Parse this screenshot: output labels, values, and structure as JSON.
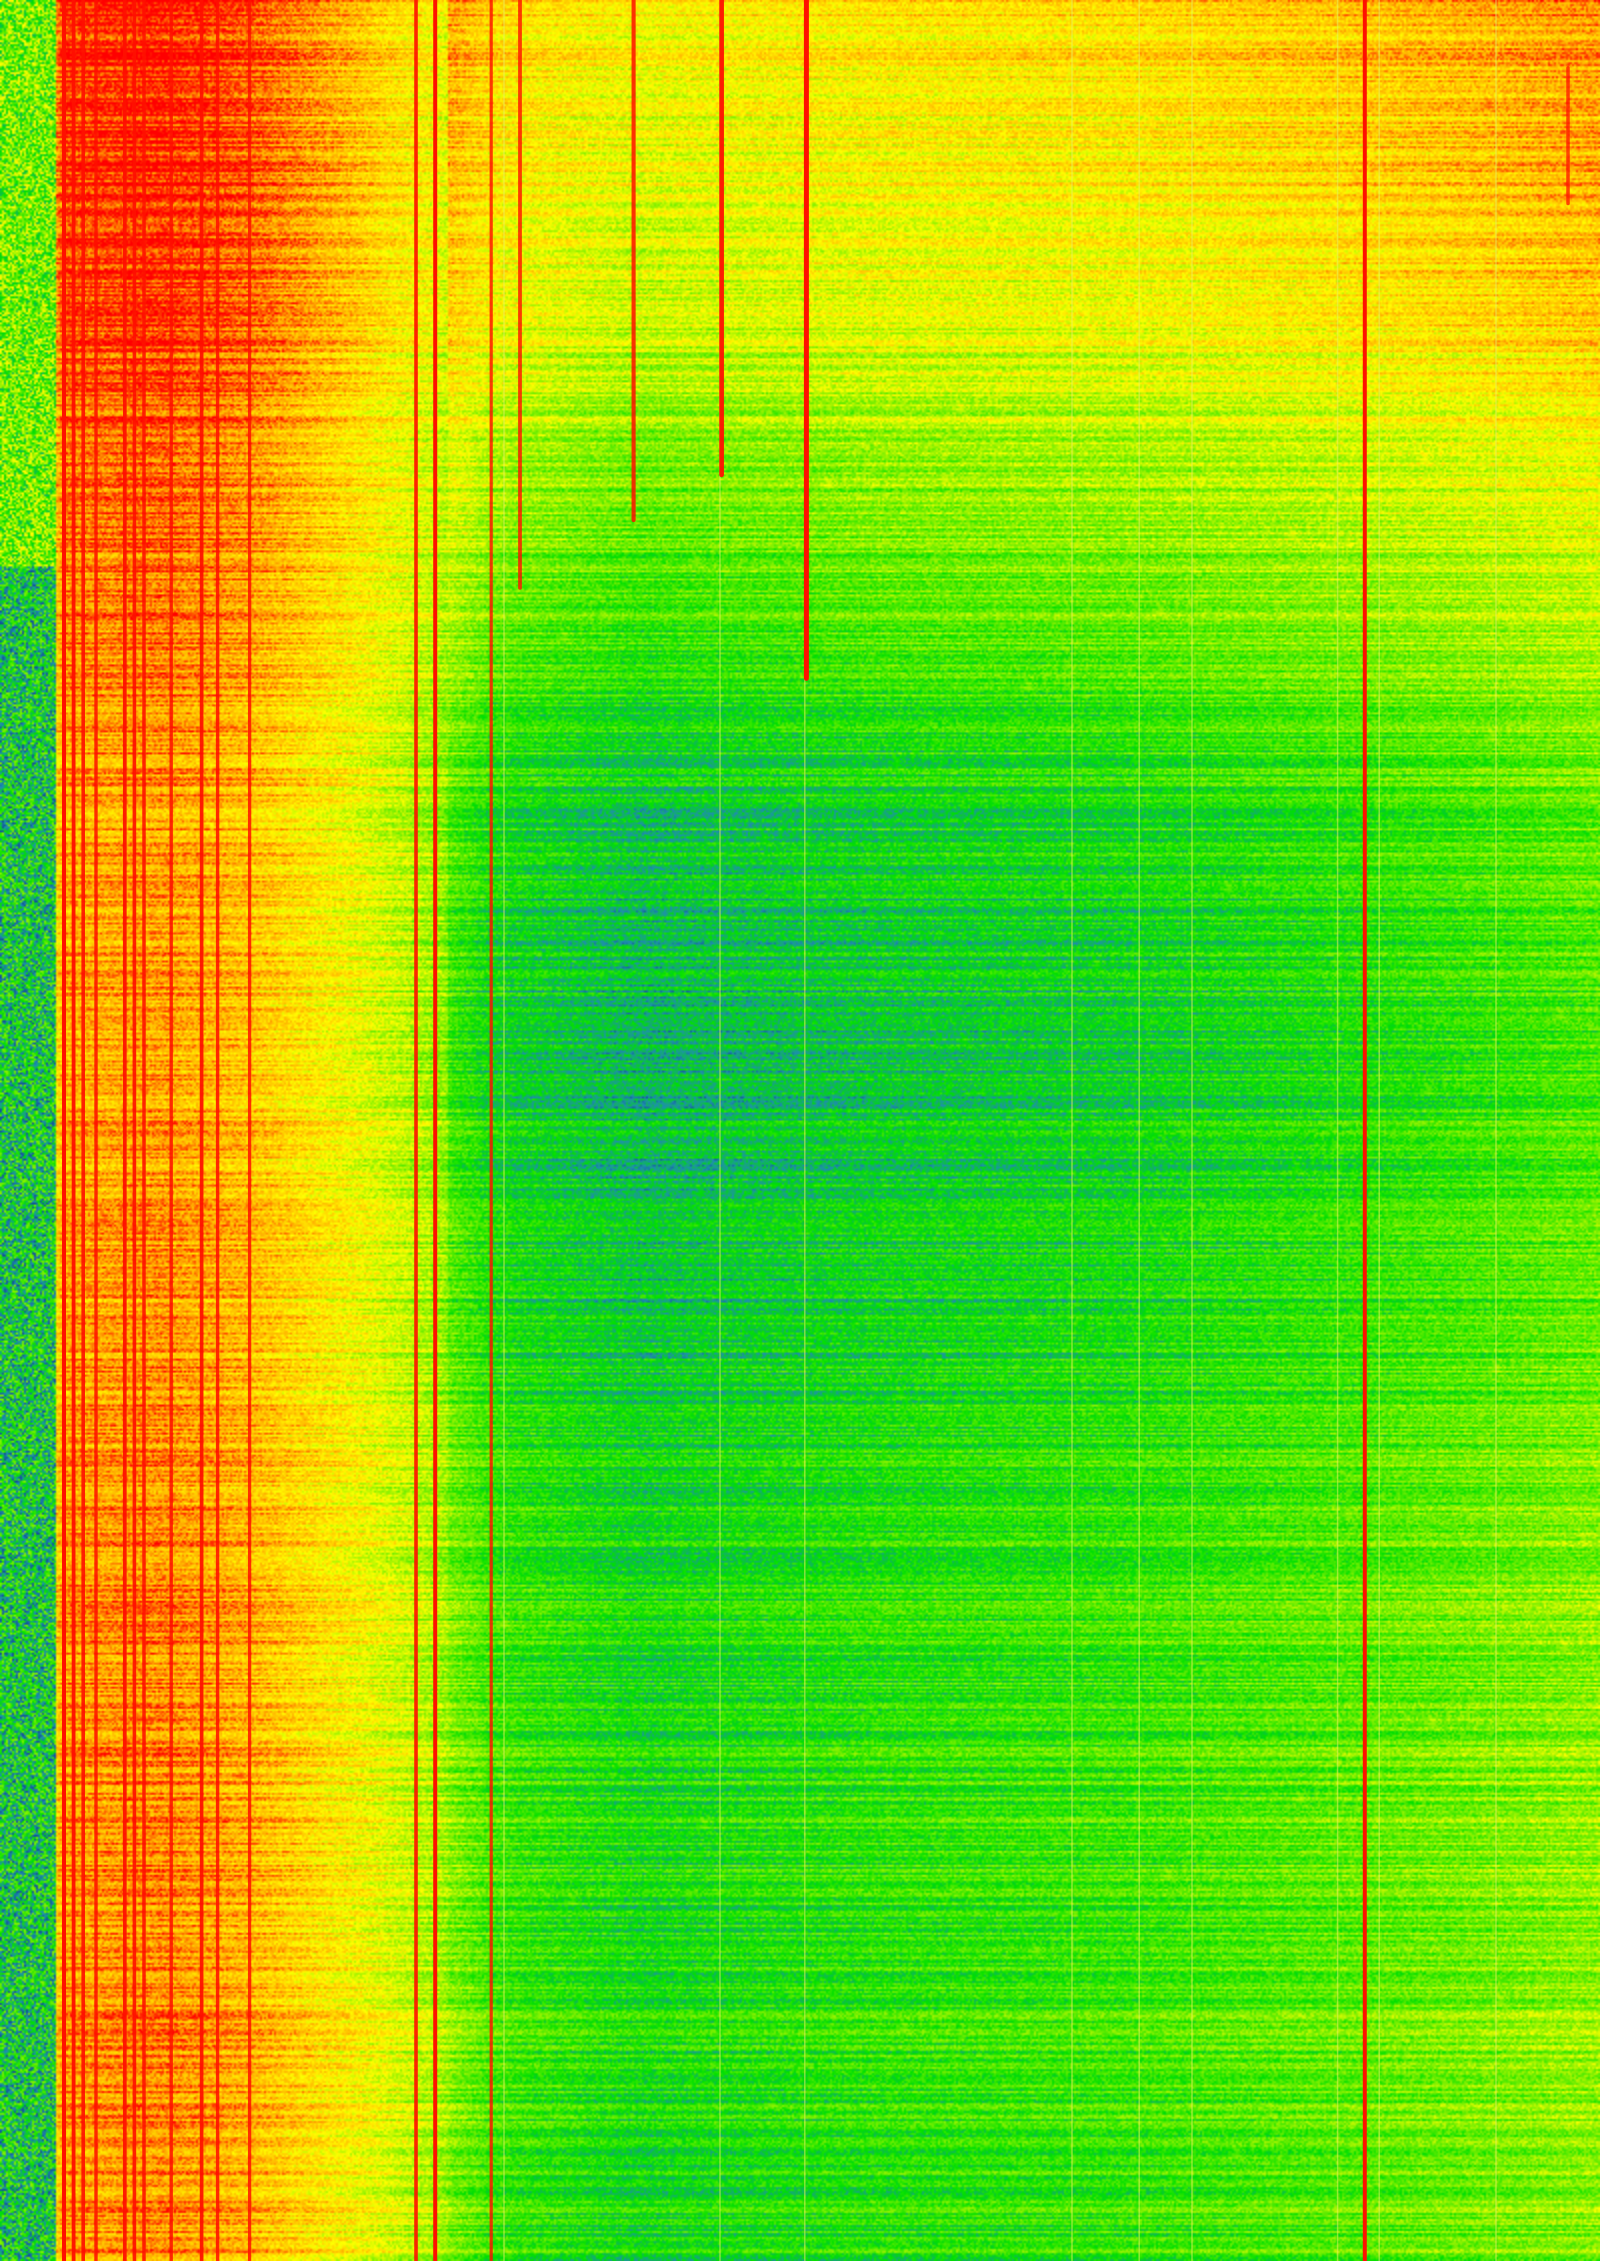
{
  "chart_data": {
    "type": "heatmap",
    "title": "",
    "xlabel": "",
    "ylabel": "",
    "colormap": [
      "#0a1a8c",
      "#1e8fb0",
      "#00e000",
      "#80f000",
      "#ffff00",
      "#ffb000",
      "#ff0000"
    ],
    "grid": false,
    "legend": "none",
    "x_range": [
      0,
      1
    ],
    "y_range": [
      0,
      1
    ],
    "background_intensity_profile": [
      {
        "x": 0.0,
        "value": 0.35
      },
      {
        "x": 0.02,
        "value": 0.55
      },
      {
        "x": 0.04,
        "value": 0.85
      },
      {
        "x": 0.1,
        "value": 0.88
      },
      {
        "x": 0.16,
        "value": 0.82
      },
      {
        "x": 0.22,
        "value": 0.7
      },
      {
        "x": 0.27,
        "value": 0.58
      },
      {
        "x": 0.31,
        "value": 0.45
      },
      {
        "x": 0.4,
        "value": 0.38
      },
      {
        "x": 0.55,
        "value": 0.42
      },
      {
        "x": 0.7,
        "value": 0.44
      },
      {
        "x": 0.82,
        "value": 0.48
      },
      {
        "x": 0.92,
        "value": 0.52
      },
      {
        "x": 1.0,
        "value": 0.56
      }
    ],
    "time_intensity_profile": [
      {
        "y": 0.0,
        "value": 0.3
      },
      {
        "y": 0.15,
        "value": 0.2
      },
      {
        "y": 0.25,
        "value": 0.05
      },
      {
        "y": 0.35,
        "value": -0.08
      },
      {
        "y": 0.45,
        "value": -0.14
      },
      {
        "y": 0.55,
        "value": -0.12
      },
      {
        "y": 0.65,
        "value": -0.06
      },
      {
        "y": 0.8,
        "value": -0.03
      },
      {
        "y": 1.0,
        "value": -0.04
      }
    ],
    "persistent_signals": [
      {
        "x": 0.04,
        "strength": 1.0
      },
      {
        "x": 0.046,
        "strength": 0.9
      },
      {
        "x": 0.052,
        "strength": 0.8
      },
      {
        "x": 0.06,
        "strength": 0.7
      },
      {
        "x": 0.078,
        "strength": 0.85
      },
      {
        "x": 0.084,
        "strength": 0.8
      },
      {
        "x": 0.09,
        "strength": 0.75
      },
      {
        "x": 0.107,
        "strength": 0.7
      },
      {
        "x": 0.126,
        "strength": 0.85
      },
      {
        "x": 0.136,
        "strength": 0.7
      },
      {
        "x": 0.156,
        "strength": 0.65
      },
      {
        "x": 0.26,
        "strength": 0.8
      },
      {
        "x": 0.272,
        "strength": 1.0
      },
      {
        "x": 0.307,
        "strength": 0.6
      },
      {
        "x": 0.853,
        "strength": 1.0
      }
    ],
    "transient_signals": [
      {
        "x": 0.504,
        "y_start": 0.0,
        "y_end": 0.3,
        "strength": 1.0
      },
      {
        "x": 0.451,
        "y_start": 0.0,
        "y_end": 0.21,
        "strength": 0.9
      },
      {
        "x": 0.396,
        "y_start": 0.0,
        "y_end": 0.23,
        "strength": 0.7
      },
      {
        "x": 0.325,
        "y_start": 0.0,
        "y_end": 0.26,
        "strength": 0.6
      },
      {
        "x": 0.98,
        "y_start": 0.03,
        "y_end": 0.09,
        "strength": 0.5
      }
    ],
    "faint_lines": [
      0.315,
      0.45,
      0.503,
      0.67,
      0.712,
      0.745,
      0.836,
      0.862,
      0.935
    ]
  }
}
